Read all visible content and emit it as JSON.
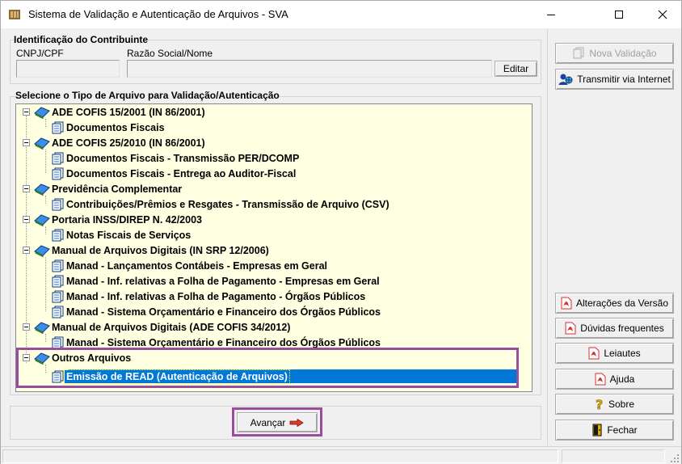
{
  "window": {
    "title": "Sistema de Validação e Autenticação de Arquivos - SVA"
  },
  "contribuinte": {
    "group_title": "Identificação do Contribuinte",
    "cnpj_label": "CNPJ/CPF",
    "razao_label": "Razão Social/Nome",
    "cnpj_value": "",
    "razao_value": "",
    "edit_label": "Editar"
  },
  "tipo_arquivo": {
    "group_title": "Selecione o Tipo de Arquivo para Validação/Autenticação",
    "tree": [
      {
        "label": "ADE COFIS 15/2001 (IN 86/2001)",
        "children": [
          "Documentos Fiscais"
        ]
      },
      {
        "label": "ADE COFIS 25/2010 (IN 86/2001)",
        "children": [
          "Documentos Fiscais - Transmissão PER/DCOMP",
          "Documentos Fiscais - Entrega ao Auditor-Fiscal"
        ]
      },
      {
        "label": "Previdência Complementar",
        "children": [
          "Contribuições/Prêmios e Resgates - Transmissão de Arquivo (CSV)"
        ]
      },
      {
        "label": "Portaria INSS/DIREP N. 42/2003",
        "children": [
          "Notas Fiscais de Serviços"
        ]
      },
      {
        "label": "Manual de Arquivos Digitais (IN SRP 12/2006)",
        "children": [
          "Manad - Lançamentos Contábeis - Empresas em Geral",
          "Manad - Inf. relativas a Folha de Pagamento - Empresas em Geral",
          "Manad - Inf. relativas a Folha de Pagamento - Órgãos Públicos",
          "Manad - Sistema Orçamentário e Financeiro dos Órgãos Públicos"
        ]
      },
      {
        "label": "Manual de Arquivos Digitais (ADE COFIS 34/2012)",
        "children": [
          "Manad - Sistema Orçamentário e Financeiro dos Órgãos Públicos"
        ]
      },
      {
        "label": "Outros Arquivos",
        "children": [
          "Emissão de READ (Autenticação de Arquivos)"
        ]
      }
    ],
    "selected": "Emissão de READ (Autenticação de Arquivos)"
  },
  "actions": {
    "avancar_label": "Avançar"
  },
  "sidebar": {
    "nova_validacao": "Nova Validação",
    "transmitir": "Transmitir via Internet",
    "alteracoes": "Alterações da Versão",
    "duvidas": "Dúvidas frequentes",
    "leiautes": "Leiautes",
    "ajuda": "Ajuda",
    "sobre": "Sobre",
    "fechar": "Fechar"
  },
  "colors": {
    "tree_background": "#ffffe1",
    "selection": "#0078d7",
    "highlight_box": "#9b4d9b",
    "pdf_red": "#d32f2f"
  }
}
